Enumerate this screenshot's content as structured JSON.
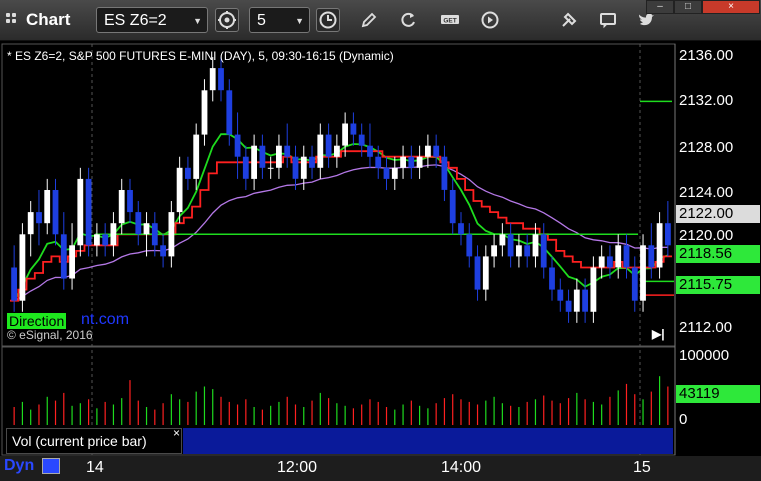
{
  "window": {
    "title": "Chart",
    "minimize": "–",
    "maximize": "□",
    "close": "×"
  },
  "toolbar": {
    "symbol_value": "ES Z6=2",
    "interval_value": "5",
    "icons": [
      "symbol-link-icon",
      "clock-icon",
      "pencil-icon",
      "refresh-icon",
      "get-icon",
      "play-icon",
      "tools-icon",
      "chat-icon",
      "twitter-icon"
    ]
  },
  "chart": {
    "header": "* ES Z6=2, S&P 500 FUTURES E-MINI (DAY), 5, 09:30-16:15 (Dynamic)",
    "watermark_brand": "Direction",
    "watermark_suffix": "nt.com",
    "copyright": "© eSignal, 2016",
    "price_axis_labels": [
      "2136.00",
      "2132.00",
      "2128.00",
      "2124.00",
      "2120.00",
      "2112.00"
    ],
    "price_tags": [
      {
        "value": "2122.00",
        "color": "#dcdcdc"
      },
      {
        "value": "2118.56",
        "color": "#2ee83a"
      },
      {
        "value": "2115.75",
        "color": "#2ee83a"
      }
    ],
    "volume_axis_labels": [
      "100000",
      "0"
    ],
    "volume_tag": "43119",
    "volume_study_label": "Vol (current price bar)",
    "volume_close": "×",
    "time_labels": [
      "14",
      "12:00",
      "14:00",
      "15"
    ],
    "bottom_label": "Dyn",
    "colors": {
      "up": "#ffffff",
      "down": "#1e3fe0",
      "red": "#ff2020",
      "green": "#1edc1e",
      "purple": "#b478e6"
    }
  },
  "chart_data": {
    "type": "candlestick",
    "ylim": [
      2110,
      2137
    ],
    "candles": [
      [
        2117,
        2119,
        2113,
        2114
      ],
      [
        2114,
        2121,
        2113,
        2120
      ],
      [
        2120,
        2123,
        2118,
        2122
      ],
      [
        2122,
        2124,
        2119,
        2121
      ],
      [
        2121,
        2125,
        2120,
        2124
      ],
      [
        2124,
        2125,
        2119,
        2120
      ],
      [
        2120,
        2122,
        2115,
        2116
      ],
      [
        2116,
        2121,
        2115,
        2119
      ],
      [
        2119,
        2126,
        2118,
        2125
      ],
      [
        2125,
        2126,
        2118,
        2119
      ],
      [
        2119,
        2121,
        2118,
        2120
      ],
      [
        2120,
        2121,
        2118,
        2119
      ],
      [
        2119,
        2122,
        2118,
        2121
      ],
      [
        2121,
        2125,
        2120,
        2124
      ],
      [
        2124,
        2125,
        2121,
        2122
      ],
      [
        2122,
        2123,
        2119,
        2120
      ],
      [
        2120,
        2122,
        2118,
        2121
      ],
      [
        2121,
        2122,
        2118,
        2119
      ],
      [
        2119,
        2120,
        2117,
        2118
      ],
      [
        2118,
        2123,
        2117,
        2122
      ],
      [
        2122,
        2127,
        2121,
        2126
      ],
      [
        2126,
        2127,
        2124,
        2125
      ],
      [
        2125,
        2130,
        2124,
        2129
      ],
      [
        2129,
        2134,
        2128,
        2133
      ],
      [
        2133,
        2136,
        2132,
        2135
      ],
      [
        2135,
        2136,
        2132,
        2133
      ],
      [
        2133,
        2134,
        2128,
        2129
      ],
      [
        2129,
        2131,
        2125,
        2127
      ],
      [
        2127,
        2128,
        2124,
        2125
      ],
      [
        2125,
        2129,
        2124,
        2128
      ],
      [
        2128,
        2129,
        2125,
        2126
      ],
      [
        2126,
        2127,
        2125,
        2126
      ],
      [
        2126,
        2129,
        2125,
        2128
      ],
      [
        2128,
        2130,
        2126,
        2127
      ],
      [
        2127,
        2128,
        2124,
        2125
      ],
      [
        2125,
        2128,
        2124,
        2127
      ],
      [
        2127,
        2128,
        2125,
        2126
      ],
      [
        2126,
        2130,
        2125,
        2129
      ],
      [
        2129,
        2130,
        2126,
        2127
      ],
      [
        2127,
        2129,
        2126,
        2128
      ],
      [
        2128,
        2131,
        2127,
        2130
      ],
      [
        2130,
        2131,
        2128,
        2129
      ],
      [
        2129,
        2130,
        2127,
        2128
      ],
      [
        2128,
        2130,
        2126,
        2127
      ],
      [
        2127,
        2128,
        2125,
        2126
      ],
      [
        2126,
        2127,
        2124,
        2125
      ],
      [
        2125,
        2127,
        2124,
        2126
      ],
      [
        2126,
        2128,
        2125,
        2127
      ],
      [
        2127,
        2128,
        2125,
        2126
      ],
      [
        2126,
        2128,
        2125,
        2127
      ],
      [
        2127,
        2129,
        2126,
        2128
      ],
      [
        2128,
        2129,
        2126,
        2127
      ],
      [
        2127,
        2128,
        2123,
        2124
      ],
      [
        2124,
        2125,
        2120,
        2121
      ],
      [
        2121,
        2122,
        2119,
        2120
      ],
      [
        2120,
        2121,
        2117,
        2118
      ],
      [
        2118,
        2119,
        2114,
        2115
      ],
      [
        2115,
        2119,
        2114,
        2118
      ],
      [
        2118,
        2120,
        2117,
        2119
      ],
      [
        2119,
        2121,
        2118,
        2120
      ],
      [
        2120,
        2121,
        2117,
        2118
      ],
      [
        2118,
        2120,
        2117,
        2119
      ],
      [
        2119,
        2120,
        2117,
        2118
      ],
      [
        2118,
        2121,
        2117,
        2120
      ],
      [
        2120,
        2121,
        2116,
        2117
      ],
      [
        2117,
        2118,
        2114,
        2115
      ],
      [
        2115,
        2116,
        2113,
        2114
      ],
      [
        2114,
        2115,
        2112,
        2113
      ],
      [
        2113,
        2116,
        2112,
        2115
      ],
      [
        2115,
        2116,
        2112,
        2113
      ],
      [
        2113,
        2118,
        2112,
        2117
      ],
      [
        2117,
        2119,
        2116,
        2118
      ],
      [
        2118,
        2119,
        2116,
        2117
      ],
      [
        2117,
        2120,
        2116,
        2119
      ],
      [
        2119,
        2120,
        2116,
        2117
      ],
      [
        2117,
        2118,
        2113,
        2114
      ],
      [
        2114,
        2120,
        2113,
        2119
      ],
      [
        2119,
        2121,
        2116,
        2117
      ],
      [
        2117,
        2122,
        2116,
        2121
      ],
      [
        2121,
        2123,
        2118,
        2119
      ]
    ],
    "volume": [
      14,
      18,
      12,
      16,
      22,
      19,
      25,
      15,
      17,
      20,
      13,
      18,
      16,
      21,
      35,
      19,
      14,
      12,
      17,
      24,
      20,
      18,
      26,
      30,
      28,
      22,
      18,
      16,
      20,
      14,
      12,
      15,
      18,
      22,
      16,
      14,
      19,
      25,
      21,
      17,
      15,
      13,
      16,
      20,
      18,
      14,
      12,
      16,
      19,
      15,
      13,
      17,
      21,
      24,
      20,
      18,
      16,
      19,
      22,
      17,
      15,
      14,
      18,
      20,
      23,
      19,
      17,
      21,
      25,
      20,
      18,
      16,
      22,
      27,
      32,
      24,
      20,
      26,
      38,
      30
    ],
    "volume_max": 100000
  }
}
